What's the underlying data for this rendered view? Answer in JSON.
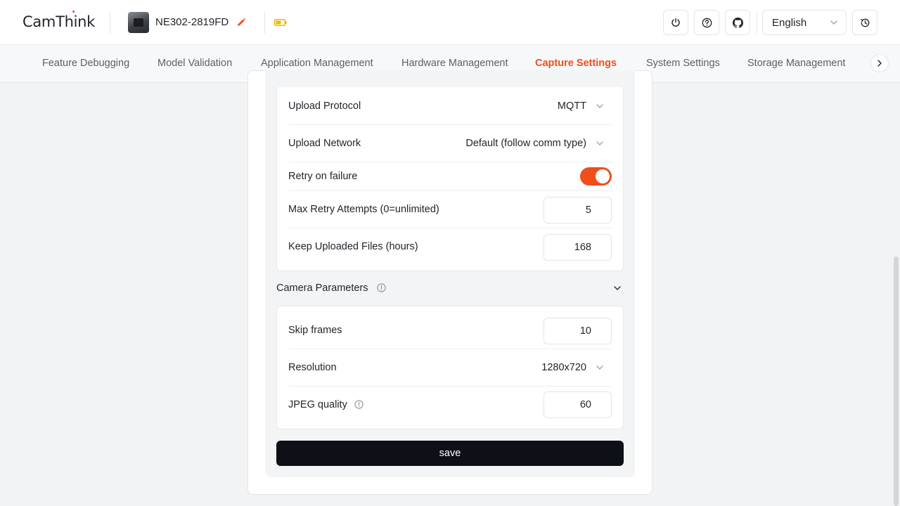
{
  "header": {
    "logo": "CamThink",
    "device_name": "NE302-2819FD",
    "language": "English"
  },
  "tabs": [
    {
      "label": "Feature Debugging"
    },
    {
      "label": "Model Validation"
    },
    {
      "label": "Application Management"
    },
    {
      "label": "Hardware Management"
    },
    {
      "label": "Capture Settings",
      "active": true
    },
    {
      "label": "System Settings"
    },
    {
      "label": "Storage Management"
    }
  ],
  "upload": {
    "protocol_label": "Upload Protocol",
    "protocol_value": "MQTT",
    "network_label": "Upload Network",
    "network_value": "Default (follow comm type)",
    "retry_label": "Retry on failure",
    "retry_enabled": true,
    "max_retry_label": "Max Retry Attempts (0=unlimited)",
    "max_retry_value": "5",
    "keep_files_label": "Keep Uploaded Files (hours)",
    "keep_files_value": "168"
  },
  "camera": {
    "section_title": "Camera Parameters",
    "skip_frames_label": "Skip frames",
    "skip_frames_value": "10",
    "resolution_label": "Resolution",
    "resolution_value": "1280x720",
    "jpeg_label": "JPEG quality",
    "jpeg_value": "60"
  },
  "actions": {
    "save_label": "save"
  },
  "colors": {
    "accent": "#f04e1b",
    "save_button": "#0d1117",
    "battery": "#f5b400"
  }
}
